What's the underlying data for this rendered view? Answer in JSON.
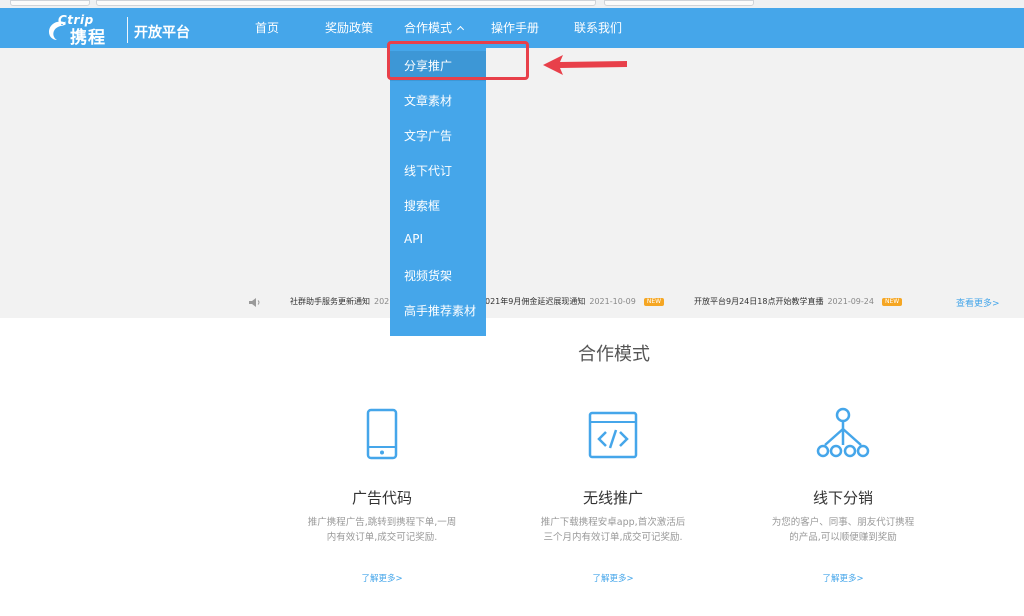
{
  "nav": {
    "logo_top": "Ctrip",
    "logo_main": "携程",
    "logo_sub": "开放平台",
    "items": [
      {
        "label": "首页"
      },
      {
        "label": "奖励政策"
      },
      {
        "label": "合作模式"
      },
      {
        "label": "操作手册"
      },
      {
        "label": "联系我们"
      }
    ]
  },
  "dropdown": {
    "items": [
      {
        "label": "分享推广"
      },
      {
        "label": "文章素材"
      },
      {
        "label": "文字广告"
      },
      {
        "label": "线下代订"
      },
      {
        "label": "搜索框"
      },
      {
        "label": "API"
      },
      {
        "label": "视频货架"
      },
      {
        "label": "高手推荐素材"
      }
    ]
  },
  "ticker": {
    "items": [
      {
        "text": "社群助手服务更新通知",
        "date": "202",
        "new": ""
      },
      {
        "text": "021年9月佣金延迟展现通知",
        "date": "2021-10-09",
        "new": "NEW"
      },
      {
        "text": "开放平台9月24日18点开始教学直播",
        "date": "2021-09-24",
        "new": "NEW"
      }
    ],
    "more": "查看更多>"
  },
  "section": {
    "title": "合作模式"
  },
  "features": [
    {
      "icon": "tablet-icon",
      "title": "广告代码",
      "desc": "推广携程广告,跳转到携程下单,一周内有效订单,成交可记奖励.",
      "link": "了解更多>"
    },
    {
      "icon": "code-window-icon",
      "title": "无线推广",
      "desc": "推广下载携程安卓app,首次激活后三个月内有效订单,成交可记奖励.",
      "link": "了解更多>"
    },
    {
      "icon": "network-tree-icon",
      "title": "线下分销",
      "desc": "为您的客户、同事、朋友代订携程的产品,可以顺便赚到奖励",
      "link": "了解更多>"
    }
  ],
  "colors": {
    "primary": "#45a6ea",
    "highlight": "#e8404a",
    "badge": "#f5a623"
  }
}
